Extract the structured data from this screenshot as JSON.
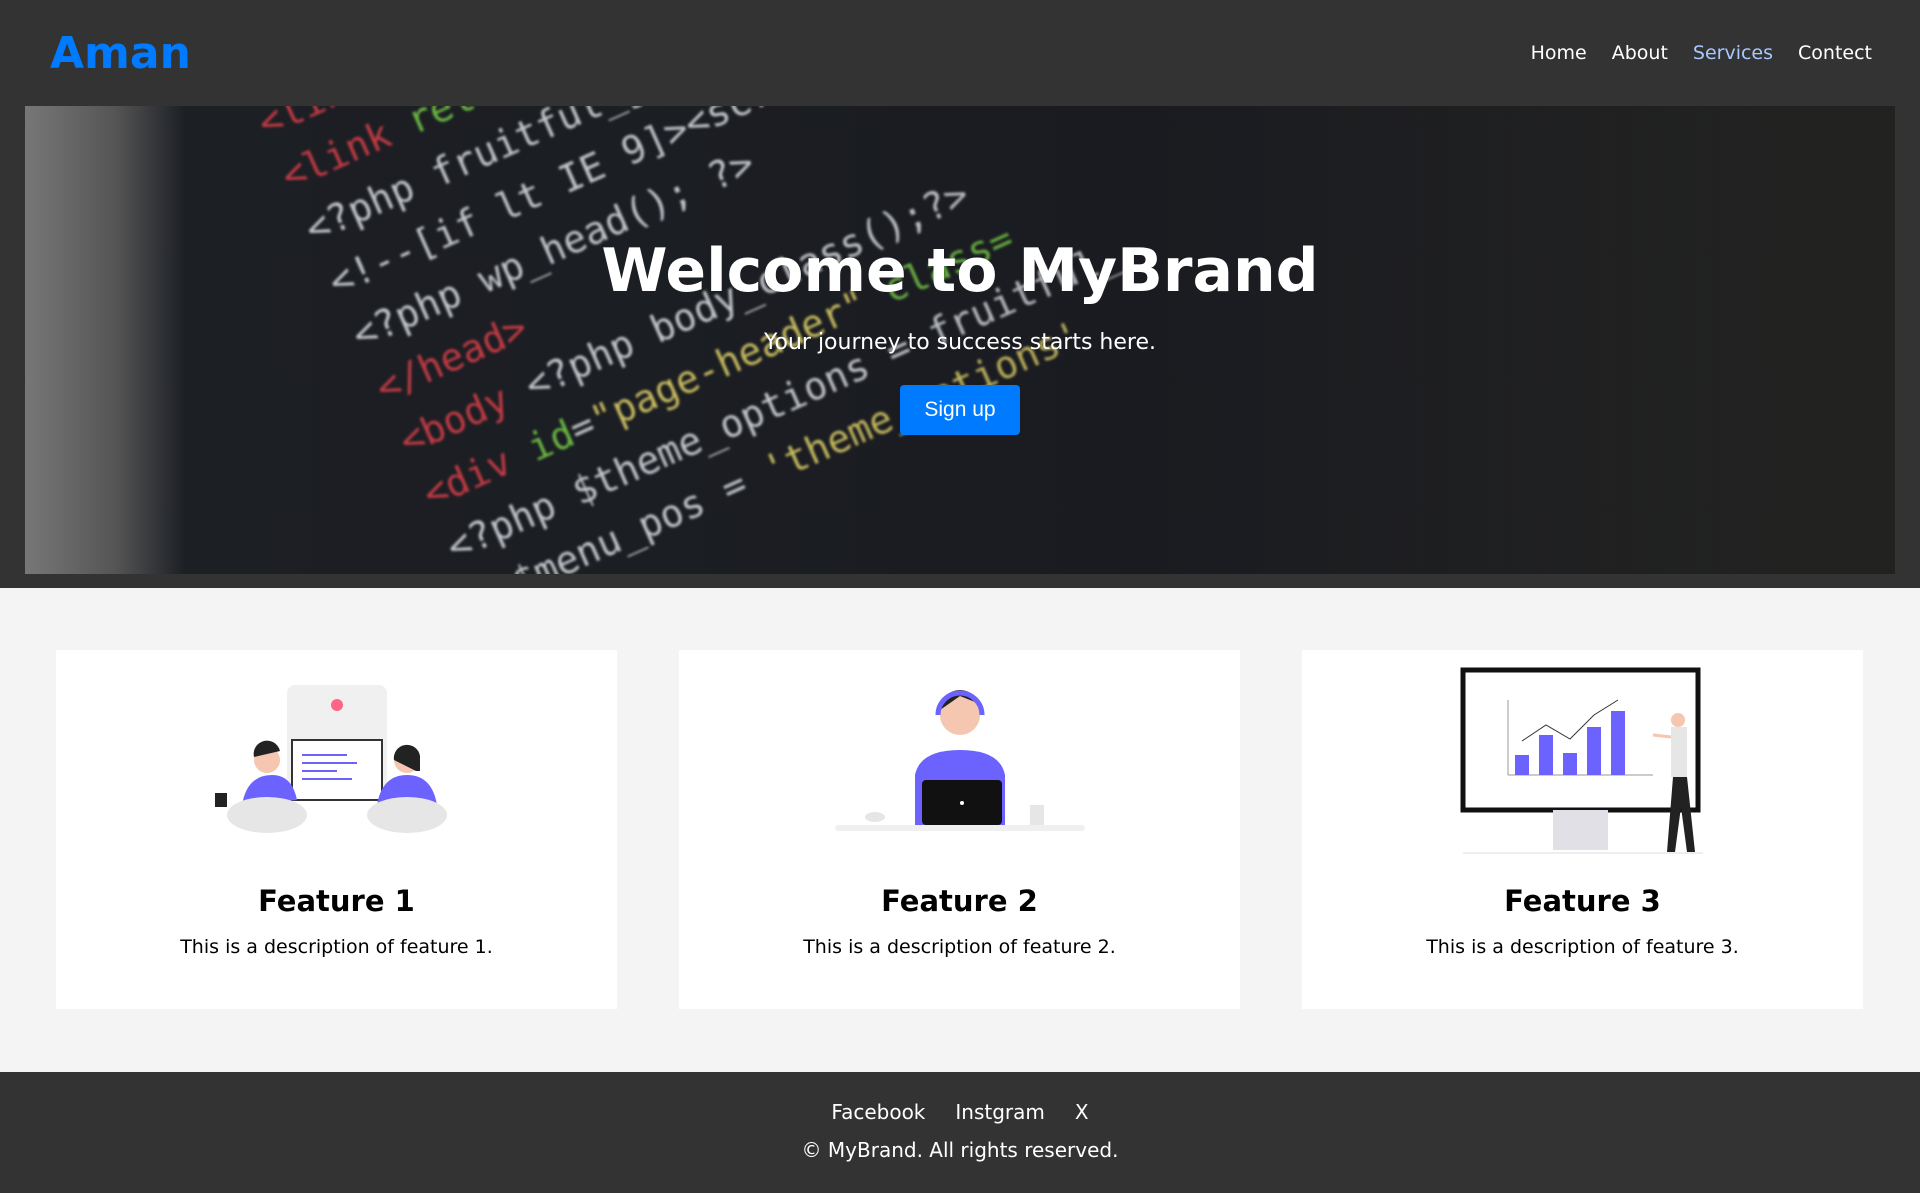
{
  "header": {
    "logo": "Aman",
    "nav": [
      "Home",
      "About",
      "Services",
      "Contect"
    ]
  },
  "hero": {
    "title": "Welcome to MyBrand",
    "subtitle": "Your journey to success starts here.",
    "cta": "Sign up"
  },
  "features": [
    {
      "title": "Feature 1",
      "description": "This is a description of feature 1."
    },
    {
      "title": "Feature 2",
      "description": "This is a description of feature 2."
    },
    {
      "title": "Feature 3",
      "description": "This is a description of feature 3."
    }
  ],
  "footer": {
    "links": [
      "Facebook",
      "Instgram",
      "X"
    ],
    "copyright": "© MyBrand. All rights reserved."
  },
  "colors": {
    "accent": "#007bff",
    "dark": "#333333",
    "bg": "#f4f4f4",
    "illustration": "#6c63ff"
  }
}
